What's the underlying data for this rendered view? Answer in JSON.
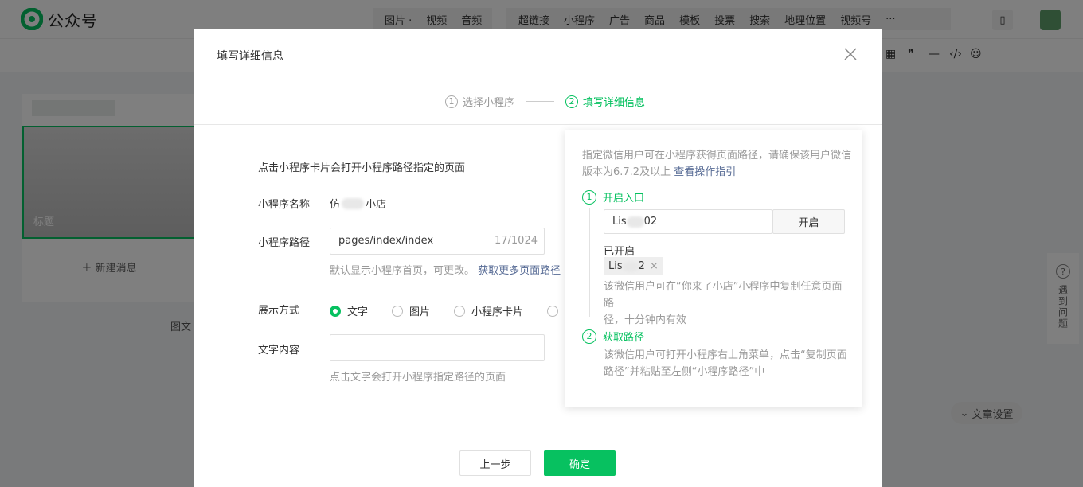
{
  "app": {
    "logo_text": "公众号"
  },
  "toolbar": {
    "group1": [
      "图片 ·",
      "视频",
      "音频"
    ],
    "group2": [
      "超链接",
      "小程序",
      "广告",
      "商品",
      "模板",
      "投票",
      "搜索",
      "地理位置",
      "视频号"
    ],
    "more": "···"
  },
  "background": {
    "card_title": "标题",
    "new_message": "新建消息",
    "partial_text": "图文",
    "article_settings": "文章设置",
    "help_widget": "遇到问题"
  },
  "modal": {
    "title": "填写详细信息",
    "steps": [
      {
        "num": "1",
        "label": "选择小程序",
        "active": false
      },
      {
        "num": "2",
        "label": "填写详细信息",
        "active": true
      }
    ],
    "description": "点击小程序卡片会打开小程序路径指定的页面",
    "name_label": "小程序名称",
    "name_value_prefix": "仿",
    "name_value_suffix": "小店",
    "path_label": "小程序路径",
    "path_value": "pages/index/index",
    "path_counter": "17/1024",
    "path_hint": "默认显示小程序首页，可更改。",
    "path_link": "获取更多页面路径",
    "display_label": "展示方式",
    "display_options": [
      {
        "label": "文字",
        "checked": true
      },
      {
        "label": "图片",
        "checked": false
      },
      {
        "label": "小程序卡片",
        "checked": false
      }
    ],
    "text_label": "文字内容",
    "text_value": "",
    "text_hint": "点击文字会打开小程序指定路径的页面",
    "prev_button": "上一步",
    "confirm_button": "确定"
  },
  "popover": {
    "intro_a": "指定微信用户可在小程序获得页面路径，请确保该用户微信",
    "intro_b": "版本为6.7.2及以上",
    "guide_link": "查看操作指引",
    "step1_num": "1",
    "step1_title": "开启入口",
    "input_prefix": "Lis",
    "input_suffix": "02",
    "open_button": "开启",
    "enabled_label": "已开启",
    "tag_prefix": "Lis",
    "tag_suffix": "2",
    "tag_close": "×",
    "step1_desc_a": "该微信用户可在“你来了小店”小程序中复制任意页面路",
    "step1_desc_b": "径，十分钟内有效",
    "step2_num": "2",
    "step2_title": "获取路径",
    "step2_desc_a": "该微信用户可打开小程序右上角菜单，点击“复制页面",
    "step2_desc_b": "路径”并粘贴至左侧“小程序路径”中"
  }
}
